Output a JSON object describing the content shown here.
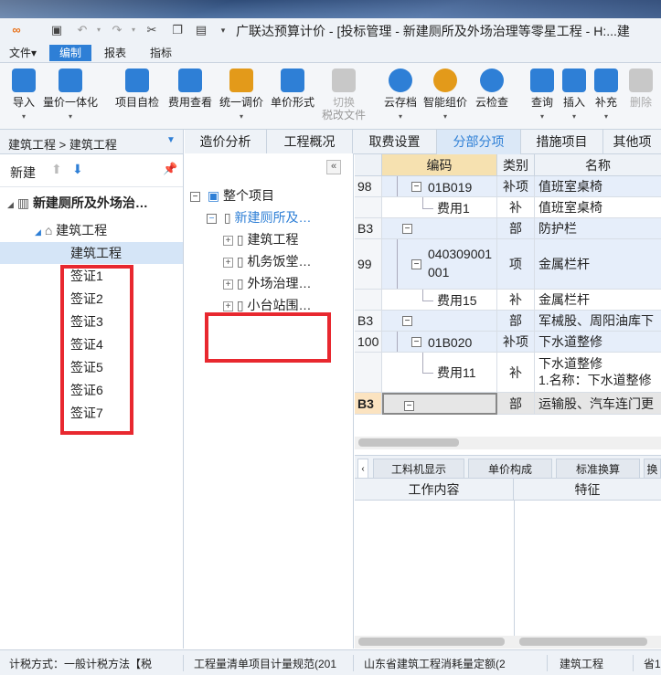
{
  "window": {
    "title": "广联达预算计价 - [投标管理 - 新建厕所及外场治理等零星工程 - H:...建"
  },
  "menu": {
    "items": [
      "文件▾",
      "编制",
      "报表",
      "指标"
    ]
  },
  "ribbon": {
    "buttons": [
      {
        "label": "导入",
        "color": "#2e7fd6"
      },
      {
        "label": "量价一体化",
        "color": "#2e7fd6"
      },
      {
        "label": "项目自检",
        "color": "#2e7fd6"
      },
      {
        "label": "费用查看",
        "color": "#2e7fd6"
      },
      {
        "label": "统一调价",
        "color": "#e39a1a"
      },
      {
        "label": "单价形式",
        "color": "#2e7fd6"
      },
      {
        "label": "切换",
        "sub": "税改文件",
        "color": "#aaaaaa"
      },
      {
        "label": "云存档",
        "color": "#2e7fd6"
      },
      {
        "label": "智能组价",
        "color": "#e39a1a"
      },
      {
        "label": "云检查",
        "color": "#2e7fd6"
      },
      {
        "label": "查询",
        "color": "#2e7fd6"
      },
      {
        "label": "插入",
        "color": "#2e7fd6"
      },
      {
        "label": "补充",
        "color": "#2e7fd6"
      },
      {
        "label": "删除",
        "color": "#aaaaaa"
      }
    ]
  },
  "left": {
    "breadcrumb": "建筑工程 > 建筑工程",
    "new_label": "新建",
    "tree": {
      "root": "新建厕所及外场治…",
      "child": "建筑工程",
      "selected": "建筑工程",
      "items": [
        "签证1",
        "签证2",
        "签证3",
        "签证4",
        "签证5",
        "签证6",
        "签证7"
      ]
    }
  },
  "middle": {
    "collapse": "«",
    "root": "整个项目",
    "project": "新建厕所及…",
    "items": [
      "建筑工程",
      "机务饭堂…",
      "外场治理…",
      "小台站围…"
    ]
  },
  "tabs": [
    "造价分析",
    "工程概况",
    "取费设置",
    "分部分项",
    "措施项目",
    "其他项"
  ],
  "grid": {
    "headers": [
      "",
      "编码",
      "类别",
      "名称"
    ],
    "rows": [
      {
        "seq": "98",
        "code": "01B019",
        "type": "补项",
        "name": "值班室桌椅",
        "style": "item"
      },
      {
        "seq": "",
        "code": "费用1",
        "type": "补",
        "name": "值班室桌椅",
        "style": "sub"
      },
      {
        "seq": "B3",
        "code": "",
        "type": "部",
        "name": "防护栏",
        "style": "section"
      },
      {
        "seq": "99",
        "code": "040309001001",
        "type": "项",
        "name": "金属栏杆",
        "style": "item2"
      },
      {
        "seq": "",
        "code": "费用15",
        "type": "补",
        "name": "金属栏杆",
        "style": "sub"
      },
      {
        "seq": "B3",
        "code": "",
        "type": "部",
        "name": "军械股、周阳油库下",
        "style": "section"
      },
      {
        "seq": "100",
        "code": "01B020",
        "type": "补项",
        "name": "下水道整修",
        "style": "item"
      },
      {
        "seq": "",
        "code": "费用11",
        "type": "补",
        "name": "下水道整修",
        "name2": "1.名称：下水道整修",
        "style": "sub2"
      },
      {
        "seq": "B3",
        "code": "",
        "type": "部",
        "name": "运输股、汽车连门更",
        "style": "section_sel"
      }
    ]
  },
  "bottom": {
    "tabs": [
      "工料机显示",
      "单价构成",
      "标准换算",
      "换"
    ],
    "headers": [
      "工作内容",
      "特征"
    ]
  },
  "status": {
    "items": [
      "计税方式：一般计税方法【税",
      "工程量清单项目计量规范(201",
      "山东省建筑工程消耗量定额(2",
      "建筑工程",
      "省1"
    ]
  }
}
